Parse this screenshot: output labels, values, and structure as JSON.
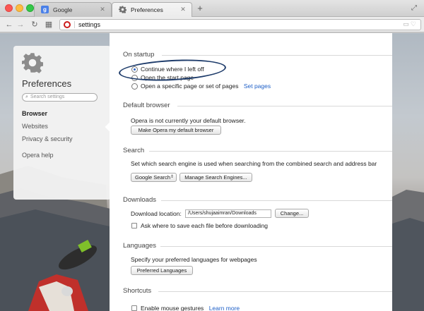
{
  "tabs": [
    {
      "label": "Google",
      "favicon": "google-icon"
    },
    {
      "label": "Preferences",
      "favicon": "gear-icon",
      "active": true
    }
  ],
  "address_bar": {
    "value": "settings"
  },
  "sidebar": {
    "title": "Preferences",
    "search_placeholder": "Search settings",
    "items": [
      {
        "label": "Browser",
        "active": true
      },
      {
        "label": "Websites"
      },
      {
        "label": "Privacy & security"
      },
      {
        "label": "Opera help"
      }
    ]
  },
  "startup": {
    "heading": "On startup",
    "options": [
      {
        "label": "Continue where I left off",
        "selected": true
      },
      {
        "label": "Open the start page",
        "selected": false
      },
      {
        "label": "Open a specific page or set of pages",
        "selected": false
      }
    ],
    "set_pages_link": "Set pages"
  },
  "default_browser": {
    "heading": "Default browser",
    "status": "Opera is not currently your default browser.",
    "button": "Make Opera my default browser"
  },
  "search": {
    "heading": "Search",
    "description": "Set which search engine is used when searching from the combined search and address bar",
    "selected_engine": "Google Search",
    "manage_button": "Manage Search Engines..."
  },
  "downloads": {
    "heading": "Downloads",
    "location_label": "Download location:",
    "location_value": "/Users/shujaaimran/Downloads",
    "change_button": "Change...",
    "ask_label": "Ask where to save each file before downloading",
    "ask_checked": false
  },
  "languages": {
    "heading": "Languages",
    "description": "Specify your preferred languages for webpages",
    "button": "Preferred Languages"
  },
  "shortcuts": {
    "heading": "Shortcuts",
    "gestures_label": "Enable mouse gestures",
    "gestures_checked": false,
    "learn_more_link": "Learn more"
  },
  "colors": {
    "accent": "#1e5fc7",
    "opera_red": "#cc1b1b",
    "annotation_oval": "#1d3b6a"
  }
}
